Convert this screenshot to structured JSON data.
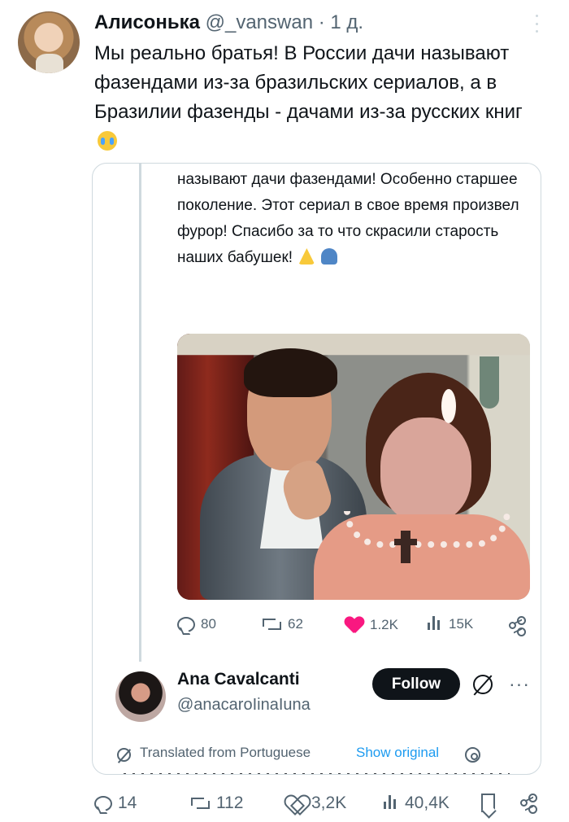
{
  "main_tweet": {
    "author_name": "Алисонька",
    "handle": "@_vanswan",
    "separator": "·",
    "age": "1 д.",
    "text": "Мы реально братья! В России дачи называют фазендами из-за бразильских сериалов, а в Бразилии фазенды - дачами из-за русских книг",
    "emoji_icon": "loudly-crying-face"
  },
  "quoted_thread": {
    "reply_text": "называют дачи фазендами! Особенно старшее поколение. Этот сериал в свое время произвел фурор! Спасибо за то что скрасили старость наших бабушек!",
    "emoji_icons": [
      "folded-hands",
      "people-hugging"
    ],
    "image_description_icon": "telenovela-still",
    "metrics": {
      "replies": "80",
      "reposts": "62",
      "likes": "1.2K",
      "views": "15K"
    },
    "colors": {
      "like_active": "#f91880",
      "link": "#1d9bf0",
      "muted": "#536471"
    }
  },
  "quoted_profile": {
    "name": "Ana Cavalcanti",
    "handle": "@anacaroIinaIuna",
    "follow_label": "Follow",
    "more_label": "···",
    "translated_label": "Translated from Portuguese",
    "show_original_label": "Show original"
  },
  "bottom_actions": {
    "replies": "14",
    "reposts": "112",
    "likes": "3,2K",
    "views": "40,4K"
  }
}
